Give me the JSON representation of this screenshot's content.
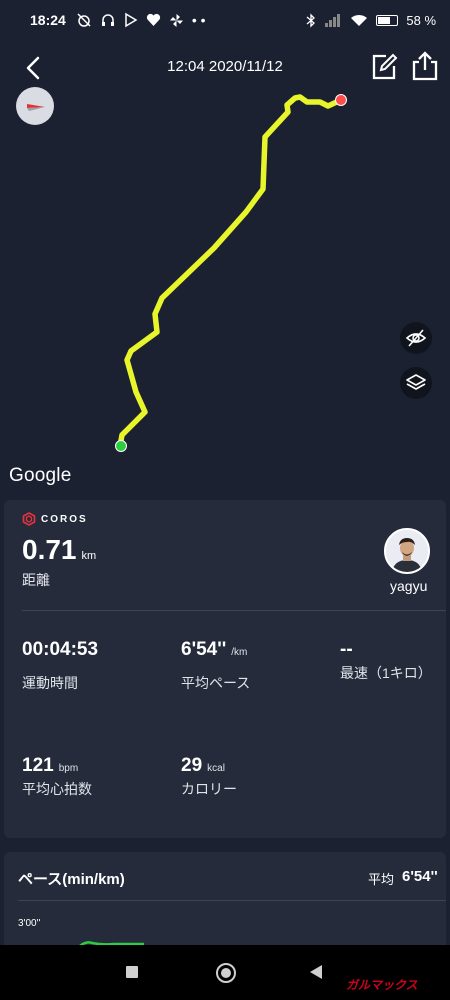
{
  "status_bar": {
    "time": "18:24",
    "battery_percent": "58",
    "battery_unit": "%",
    "left_icons": [
      "alarm-off-icon",
      "headset-icon",
      "play-icon",
      "heart-icon",
      "pinwheel-icon",
      "more-dots-icon"
    ],
    "right_icons": [
      "bluetooth-icon",
      "signal-icon",
      "wifi-icon",
      "battery-icon"
    ]
  },
  "header": {
    "title": "12:04 2020/11/12",
    "icons": [
      "back-icon",
      "edit-icon",
      "share-icon"
    ]
  },
  "map": {
    "attribution": "Google",
    "route_color": "#e8f52b",
    "start_color": "#2ecc40",
    "end_color": "#ff4d4d",
    "controls": [
      "compass-icon",
      "eye-off-icon",
      "layers-icon"
    ]
  },
  "summary": {
    "brand": "COROS",
    "distance_value": "0.71",
    "distance_unit": "km",
    "distance_label": "距離",
    "username": "yagyu",
    "stats": [
      {
        "value": "00:04:53",
        "unit": "",
        "label": "運動時間"
      },
      {
        "value": "6'54''",
        "unit": "/km",
        "label": "平均ペース"
      },
      {
        "value": "--",
        "unit": "",
        "label": "最速（1キロ）"
      },
      {
        "value": "121",
        "unit": "bpm",
        "label": "平均心拍数"
      },
      {
        "value": "29",
        "unit": "kcal",
        "label": "カロリー"
      }
    ]
  },
  "pace": {
    "title": "ペース(min/km)",
    "avg_label": "平均",
    "avg_value": "6'54''",
    "tick": "3'00''",
    "line_color": "#2ecc40"
  },
  "watermark": "ガルマックス",
  "colors": {
    "background": "#1b2130",
    "card": "#252b3b",
    "accent_route": "#e8f52b"
  }
}
